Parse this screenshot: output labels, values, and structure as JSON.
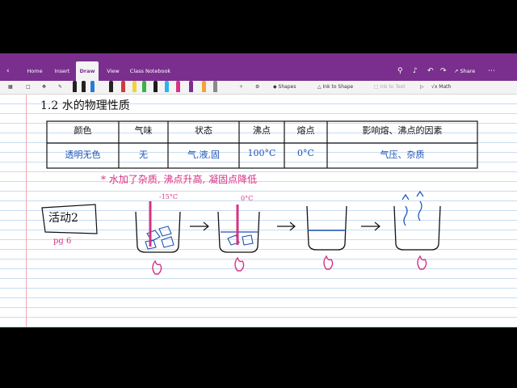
{
  "ribbon": {
    "tabs": [
      {
        "label": "Home"
      },
      {
        "label": "Insert"
      },
      {
        "label": "Draw"
      },
      {
        "label": "View"
      },
      {
        "label": "Class Notebook"
      }
    ],
    "share_label": "Share",
    "accent": "#7a2f8e"
  },
  "toolbar": {
    "shapes_label": "Shapes",
    "ink_to_shape_label": "Ink to Shape",
    "ink_to_text_label": "Ink to Text",
    "math_label": "Math",
    "pen_colors": [
      "#222222",
      "#222222",
      "#2a7bd6",
      "#222222",
      "#d33a3a",
      "#f2d23a",
      "#37b24d",
      "#1c1c1c",
      "#2ab3f0",
      "#d63384",
      "#7a2f8e",
      "#f2a23a"
    ]
  },
  "note": {
    "heading": "1.2 水的物理性质",
    "table": {
      "headers": [
        "颜色",
        "气味",
        "状态",
        "沸点",
        "熔点",
        "影响熔、沸点的因素"
      ],
      "row": [
        "透明无色",
        "无",
        "气,液,固",
        "100°C",
        "0°C",
        "气压、杂质"
      ]
    },
    "remark": "* 水加了杂质, 沸点升高, 凝固点降低",
    "activity_label": "活动2",
    "page_ref": "pg 6",
    "beaker1_temp": "-15°C",
    "beaker2_temp": "0°C"
  }
}
